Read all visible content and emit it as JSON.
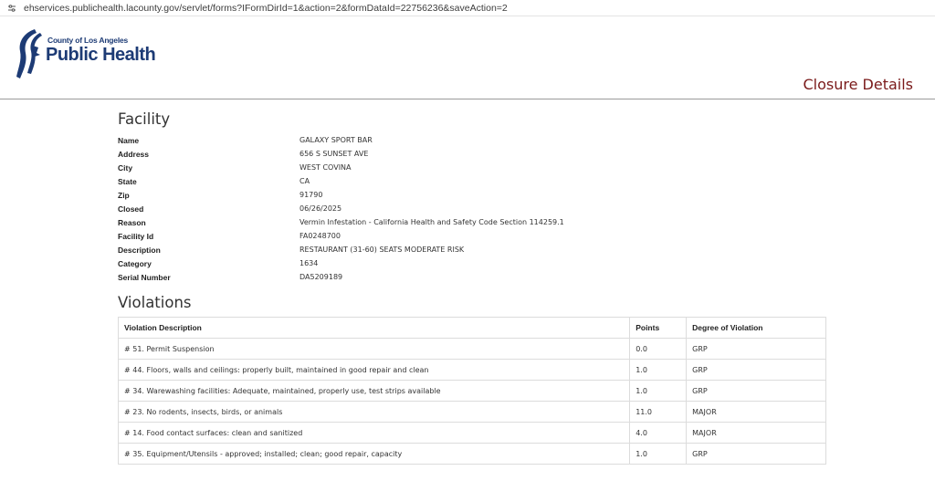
{
  "browser": {
    "url": "ehservices.publichealth.lacounty.gov/servlet/forms?IFormDirId=1&action=2&formDataId=22756236&saveAction=2"
  },
  "header": {
    "logo_top": "County of Los Angeles",
    "logo_main": "Public Health",
    "page_title": "Closure Details"
  },
  "facility": {
    "title": "Facility",
    "fields": [
      {
        "label": "Name",
        "value": "GALAXY SPORT BAR"
      },
      {
        "label": "Address",
        "value": "656 S SUNSET AVE"
      },
      {
        "label": "City",
        "value": "WEST COVINA"
      },
      {
        "label": "State",
        "value": "CA"
      },
      {
        "label": "Zip",
        "value": "91790"
      },
      {
        "label": "Closed",
        "value": "06/26/2025"
      },
      {
        "label": "Reason",
        "value": "Vermin Infestation - California Health and Safety Code Section 114259.1"
      },
      {
        "label": "Facility Id",
        "value": "FA0248700"
      },
      {
        "label": "Description",
        "value": "RESTAURANT (31-60) SEATS MODERATE RISK"
      },
      {
        "label": "Category",
        "value": "1634"
      },
      {
        "label": "Serial Number",
        "value": "DA5209189"
      }
    ]
  },
  "violations": {
    "title": "Violations",
    "columns": [
      "Violation Description",
      "Points",
      "Degree of Violation"
    ],
    "rows": [
      [
        "# 51. Permit Suspension",
        "0.0",
        "GRP"
      ],
      [
        "# 44. Floors, walls and ceilings: properly built, maintained in good repair and clean",
        "1.0",
        "GRP"
      ],
      [
        "# 34. Warewashing facilities: Adequate, maintained, properly use, test strips available",
        "1.0",
        "GRP"
      ],
      [
        "# 23. No rodents, insects, birds, or animals",
        "11.0",
        "MAJOR"
      ],
      [
        "# 14. Food contact surfaces: clean and sanitized",
        "4.0",
        "MAJOR"
      ],
      [
        "# 35. Equipment/Utensils - approved; installed; clean; good repair, capacity",
        "1.0",
        "GRP"
      ]
    ]
  }
}
